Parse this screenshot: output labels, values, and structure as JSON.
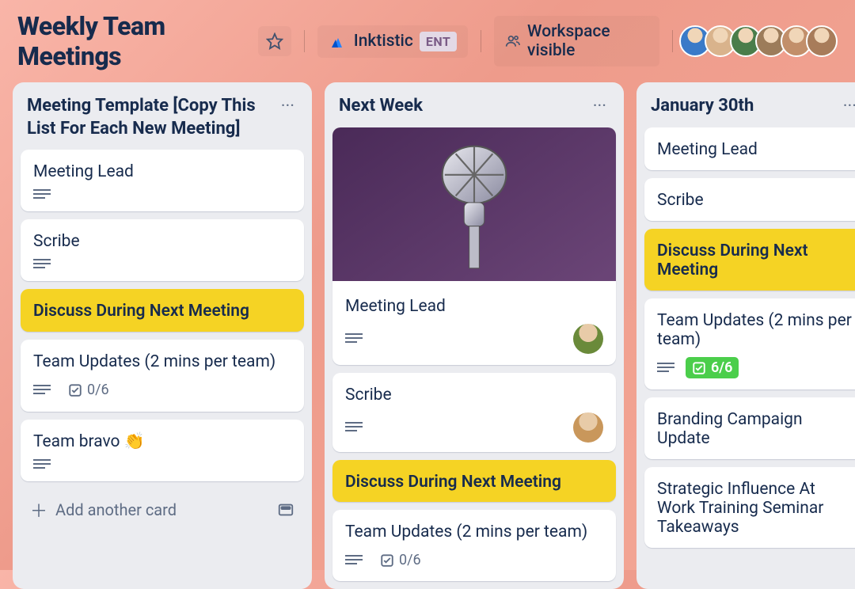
{
  "header": {
    "board_title": "Weekly Team Meetings",
    "workspace_name": "Inktistic",
    "workspace_badge": "ENT",
    "visibility_label": "Workspace visible",
    "avatar_colors": [
      "#3a7ac8",
      "#d9b38c",
      "#4a7d4a",
      "#9c7c5a",
      "#c28f6a",
      "#a87c5a"
    ]
  },
  "lists": [
    {
      "title": "Meeting Template [Copy This List For Each New Meeting]",
      "cards": [
        {
          "title": "Meeting Lead",
          "has_desc": true
        },
        {
          "title": "Scribe",
          "has_desc": true
        },
        {
          "title": "Discuss During Next Meeting",
          "style": "yellow"
        },
        {
          "title": "Team Updates (2 mins per team)",
          "has_desc": true,
          "checklist": "0/6"
        },
        {
          "title": "Team bravo 👏",
          "has_desc": true
        }
      ],
      "add_label": "Add another card"
    },
    {
      "title": "Next Week",
      "cards": [
        {
          "title": "Meeting Lead",
          "has_desc": true,
          "cover": true,
          "avatar": "#6a8a3a"
        },
        {
          "title": "Scribe",
          "has_desc": true,
          "avatar": "#c9975b"
        },
        {
          "title": "Discuss During Next Meeting",
          "style": "yellow"
        },
        {
          "title": "Team Updates (2 mins per team)",
          "has_desc": true,
          "checklist": "0/6"
        }
      ]
    },
    {
      "title": "January 30th",
      "cards": [
        {
          "title": "Meeting Lead"
        },
        {
          "title": "Scribe"
        },
        {
          "title": "Discuss During Next Meeting",
          "style": "yellow",
          "truncated": true
        },
        {
          "title": "Team Updates (2 mins per team)",
          "has_desc": true,
          "checklist": "6/6",
          "checklist_done": true,
          "truncated": true
        },
        {
          "title": "Branding Campaign Update",
          "truncated": true
        },
        {
          "title": "Strategic Influence At Work Training Seminar Takeaways",
          "truncated": true
        }
      ]
    }
  ]
}
